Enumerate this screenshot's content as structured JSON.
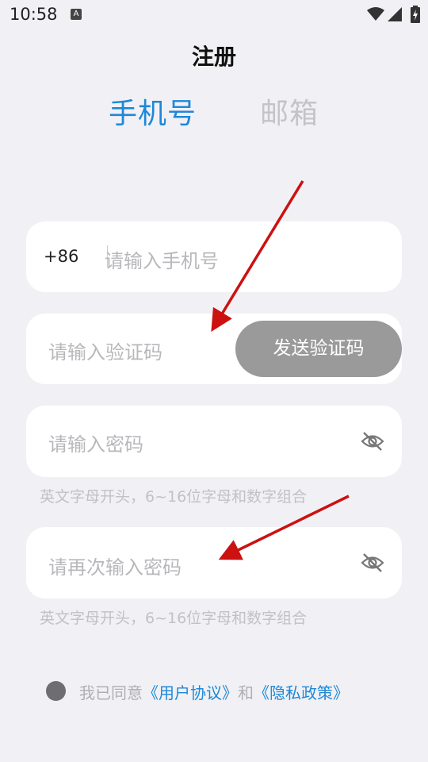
{
  "status_bar": {
    "time": "10:58",
    "notification_icon": "a-icon",
    "icons": [
      "wifi-icon",
      "signal-icon",
      "battery-charging-icon"
    ]
  },
  "page": {
    "title": "注册"
  },
  "tabs": {
    "phone": {
      "label": "手机号",
      "active": true
    },
    "email": {
      "label": "邮箱",
      "active": false
    }
  },
  "form": {
    "phone": {
      "prefix": "+86",
      "placeholder": "请输入手机号"
    },
    "code": {
      "placeholder": "请输入验证码",
      "send_label": "发送验证码"
    },
    "password": {
      "placeholder": "请输入密码",
      "hint": "英文字母开头，6~16位字母和数字组合"
    },
    "password_confirm": {
      "placeholder": "请再次输入密码",
      "hint": "英文字母开头，6~16位字母和数字组合"
    }
  },
  "agreement": {
    "prefix": "我已同意",
    "user_agreement": "《用户协议》",
    "and": "和",
    "privacy_policy": "《隐私政策》"
  },
  "colors": {
    "accent": "#1e88d8",
    "inactive_tab": "#c4c4c8",
    "background": "#f1f1f5",
    "send_button": "#9a9a9a",
    "annotation_arrow": "#cc1111"
  }
}
